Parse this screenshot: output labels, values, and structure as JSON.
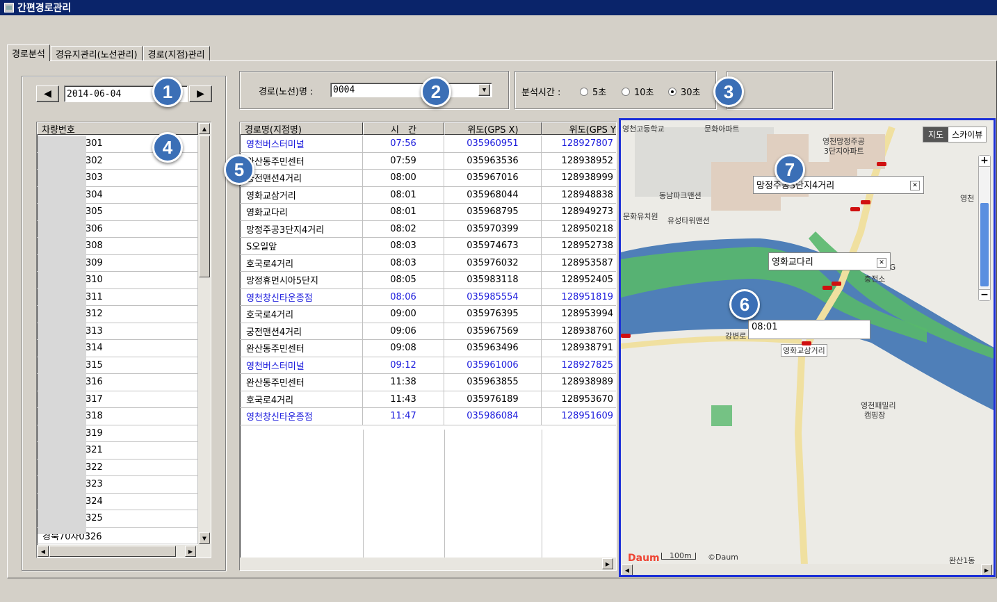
{
  "window": {
    "title": "간편경로관리"
  },
  "tabs": [
    {
      "label": "경로분석",
      "active": true
    },
    {
      "label": "경유지관리(노선관리)",
      "active": false
    },
    {
      "label": "경로(지점)관리",
      "active": false
    }
  ],
  "date_nav": {
    "prev_icon": "◀",
    "date": "2014-06-04",
    "next_icon": "▶"
  },
  "route": {
    "label": "경로(노선)명 :",
    "value": "0004"
  },
  "analysis": {
    "label": "분석시간 :",
    "options": [
      {
        "label": "5초",
        "selected": false
      },
      {
        "label": "10초",
        "selected": false
      },
      {
        "label": "30초",
        "selected": true
      }
    ]
  },
  "vehicles": {
    "header": "차량번호",
    "items": [
      "301",
      "302",
      "303",
      "304",
      "305",
      "306",
      "308",
      "309",
      "310",
      "311",
      "312",
      "313",
      "314",
      "315",
      "316",
      "317",
      "318",
      "319",
      "321",
      "322",
      "323",
      "324",
      "325",
      "경북70자0326"
    ]
  },
  "route_table": {
    "headers": [
      "경로명(지점명)",
      "시　간",
      "위도(GPS X)",
      "위도(GPS Y"
    ],
    "rows": [
      {
        "name": "영천버스터미널",
        "time": "07:56",
        "x": "035960951",
        "y": "128927807",
        "highlight": true
      },
      {
        "name": "완산동주민센터",
        "time": "07:59",
        "x": "035963536",
        "y": "128938952",
        "highlight": false
      },
      {
        "name": "궁전맨션4거리",
        "time": "08:00",
        "x": "035967016",
        "y": "128938999",
        "highlight": false
      },
      {
        "name": "영화교삼거리",
        "time": "08:01",
        "x": "035968044",
        "y": "128948838",
        "highlight": false
      },
      {
        "name": "영화교다리",
        "time": "08:01",
        "x": "035968795",
        "y": "128949273",
        "highlight": false
      },
      {
        "name": "망정주공3단지4거리",
        "time": "08:02",
        "x": "035970399",
        "y": "128950218",
        "highlight": false
      },
      {
        "name": "S오일앞",
        "time": "08:03",
        "x": "035974673",
        "y": "128952738",
        "highlight": false
      },
      {
        "name": "호국로4거리",
        "time": "08:03",
        "x": "035976032",
        "y": "128953587",
        "highlight": false
      },
      {
        "name": "망정휴먼시아5단지",
        "time": "08:05",
        "x": "035983118",
        "y": "128952405",
        "highlight": false
      },
      {
        "name": "영천창신타운종점",
        "time": "08:06",
        "x": "035985554",
        "y": "128951819",
        "highlight": true
      },
      {
        "name": "호국로4거리",
        "time": "09:00",
        "x": "035976395",
        "y": "128953994",
        "highlight": false
      },
      {
        "name": "궁전맨션4거리",
        "time": "09:06",
        "x": "035967569",
        "y": "128938760",
        "highlight": false
      },
      {
        "name": "완산동주민센터",
        "time": "09:08",
        "x": "035963496",
        "y": "128938791",
        "highlight": false
      },
      {
        "name": "영천버스터미널",
        "time": "09:12",
        "x": "035961006",
        "y": "128927825",
        "highlight": true
      },
      {
        "name": "완산동주민센터",
        "time": "11:38",
        "x": "035963855",
        "y": "128938989",
        "highlight": false
      },
      {
        "name": "호국로4거리",
        "time": "11:43",
        "x": "035976189",
        "y": "128953670",
        "highlight": false
      },
      {
        "name": "영천창신타운종점",
        "time": "11:47",
        "x": "035986084",
        "y": "128951609",
        "highlight": true
      }
    ]
  },
  "map": {
    "view_tabs": [
      "지도",
      "스카이뷰"
    ],
    "labels": [
      "영천고등학교",
      "문화아파트",
      "영천망정주공",
      "3단지아파트",
      "동남파크맨션",
      "문화유치원",
      "유성타워맨션",
      "PG",
      "충전소",
      "강변로",
      "영천패밀리",
      "캠핑장",
      "완산1동",
      "영천"
    ],
    "callout_1": "망정주공3단지4거리",
    "callout_2": "영화교다리",
    "callout_3": "08:01",
    "road_label": "영화교삼거리",
    "scale": "100m",
    "copyright": "©Daum",
    "logo": "Daum",
    "zoom_in": "+",
    "zoom_out": "−"
  },
  "badges": [
    "1",
    "2",
    "3",
    "4",
    "5",
    "6",
    "7"
  ],
  "colors": {
    "title_bar": "#0a246a",
    "link_blue": "#1a1adc",
    "badge": "#3b6fb6",
    "map_border": "#1c2fd8",
    "river": "#4f7fb8",
    "park": "#58b86c"
  }
}
